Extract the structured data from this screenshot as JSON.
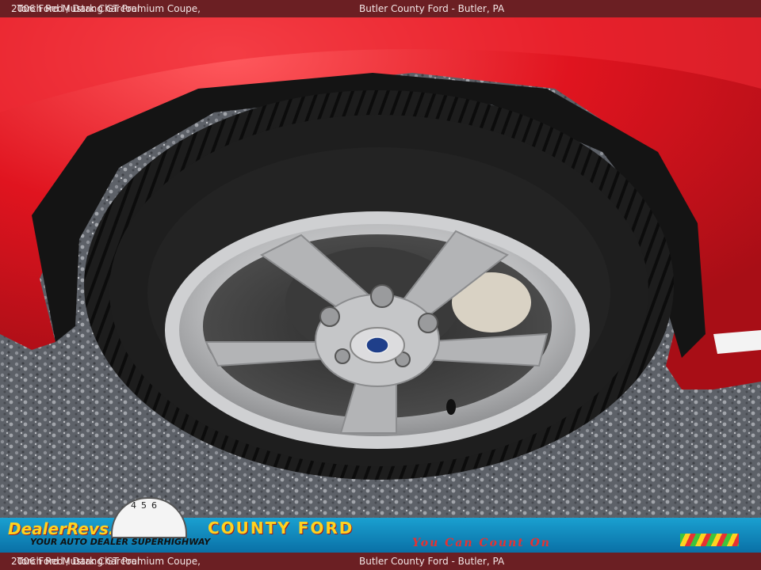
{
  "caption": {
    "title": "2006 Ford Mustang GT Premium Coupe,",
    "color": "Torch Red / Dark Charcoal",
    "dealer": "Butler County Ford - Butler, PA"
  },
  "watermark": {
    "logo_text": "DealerRevs.com",
    "tagline": "YOUR AUTO DEALER SUPERHIGHWAY",
    "dealer_name": "COUNTY FORD",
    "slogan": "You Can Count On",
    "gauge_numbers": "456"
  },
  "colors": {
    "caption_bar": "#6b1f23",
    "paint": "#d8121f",
    "banner": "#1aa0d0",
    "banner_text": "#ffd21f"
  }
}
